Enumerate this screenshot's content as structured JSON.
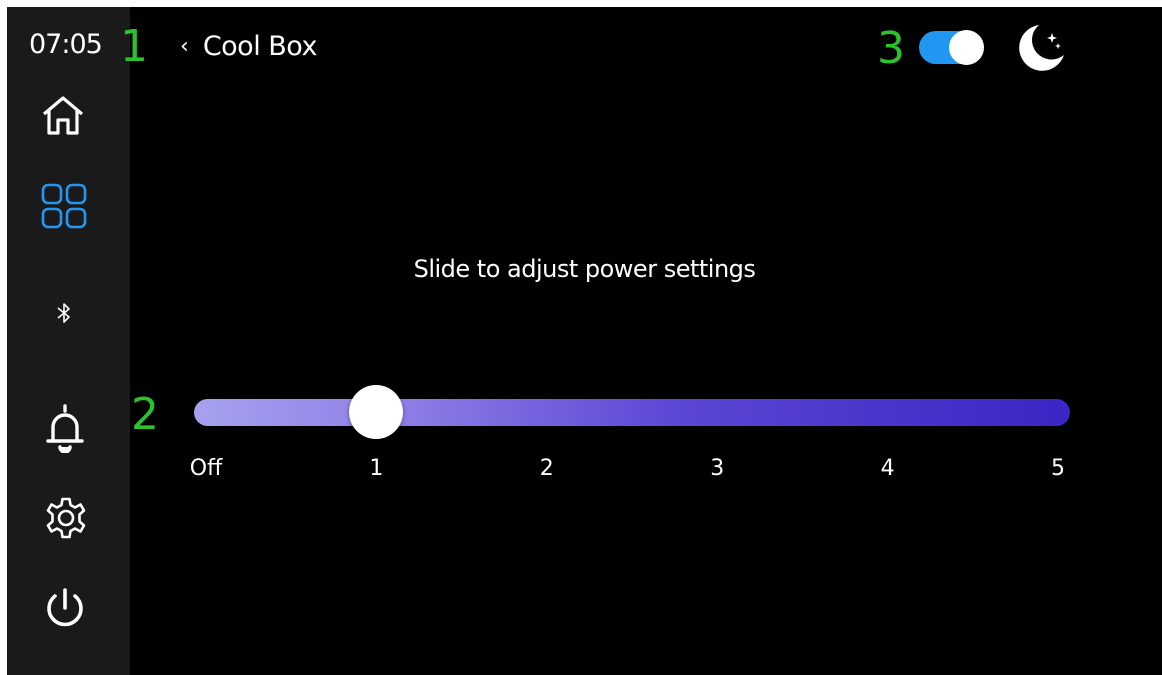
{
  "status": {
    "time": "07:05"
  },
  "header": {
    "back_chevron": "‹",
    "title": "Cool Box"
  },
  "annotations": {
    "label_1": "1",
    "label_2": "2",
    "label_3": "3"
  },
  "sidebar": {
    "items": [
      {
        "icon": "home-icon",
        "active": false
      },
      {
        "icon": "apps-grid-icon",
        "active": true
      },
      {
        "icon": "bluetooth-icon",
        "active": false
      },
      {
        "icon": "bell-icon",
        "active": false
      },
      {
        "icon": "gear-icon",
        "active": false
      },
      {
        "icon": "power-icon",
        "active": false
      }
    ]
  },
  "toggle": {
    "on": true
  },
  "night_mode_icon": "moon-stars-icon",
  "main": {
    "instruction": "Slide to adjust power settings",
    "slider": {
      "ticks": [
        "Off",
        "1",
        "2",
        "3",
        "4",
        "5"
      ],
      "current_level": 1,
      "max_level": 5,
      "gradient_start": "#a7a2ef",
      "gradient_end": "#3a25c5"
    }
  },
  "colors": {
    "background": "#000000",
    "sidebar": "#1a1a1a",
    "accent": "#2196f3",
    "annotation": "#2bc22b"
  }
}
